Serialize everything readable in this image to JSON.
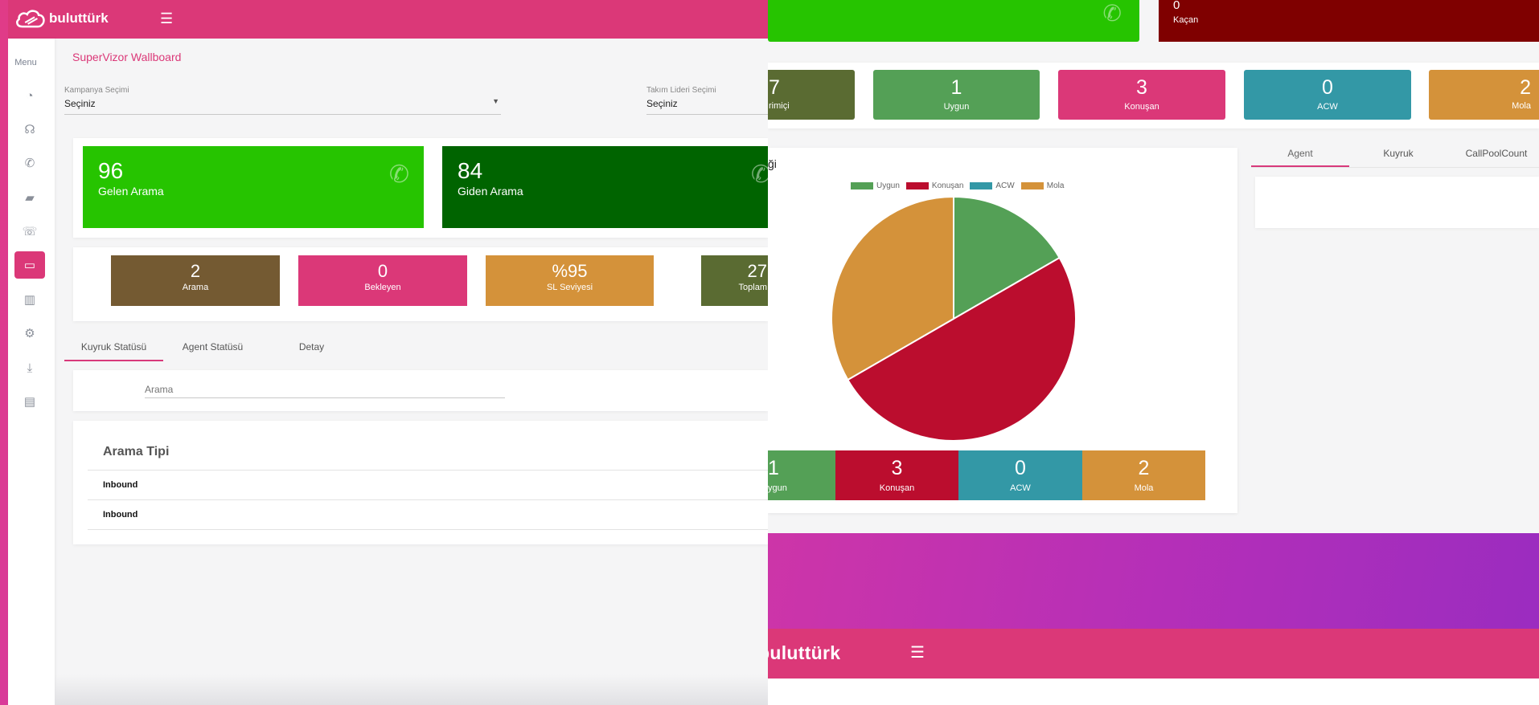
{
  "brand": {
    "name": "buluttürk",
    "primary_color": "#db3878",
    "menu_icon": "hamburger-icon"
  },
  "right_window": {
    "top_stats": [
      {
        "value": "",
        "label": "",
        "color": "#26c400"
      },
      {
        "value": "0",
        "label": "Kaçan",
        "color": "#7f0000"
      }
    ],
    "agent_stats": [
      {
        "value": "7",
        "label": "rimiçi",
        "color": "#5a6b32"
      },
      {
        "value": "1",
        "label": "Uygun",
        "color": "#54a056"
      },
      {
        "value": "3",
        "label": "Konuşan",
        "color": "#db3878"
      },
      {
        "value": "0",
        "label": "ACW",
        "color": "#3398a6"
      },
      {
        "value": "2",
        "label": "Mola",
        "color": "#d4923a"
      }
    ],
    "pie_title_fragment": "ği",
    "legend": [
      "Uygun",
      "Konuşan",
      "ACW",
      "Mola"
    ],
    "bottom_stats": [
      {
        "value": "1",
        "label": "ygun",
        "color": "#54a056"
      },
      {
        "value": "3",
        "label": "Konuşan",
        "color": "#bb0d2e"
      },
      {
        "value": "0",
        "label": "ACW",
        "color": "#3398a6"
      },
      {
        "value": "2",
        "label": "Mola",
        "color": "#d4923a"
      }
    ],
    "tabs": [
      "Agent",
      "Kuyruk",
      "CallPoolCount"
    ]
  },
  "chart_data": {
    "type": "pie",
    "categories": [
      "Uygun",
      "Konuşan",
      "ACW",
      "Mola"
    ],
    "values": [
      1,
      3,
      0,
      2
    ],
    "colors": [
      "#54a056",
      "#bb0d2e",
      "#3398a6",
      "#d4923a"
    ],
    "legend": "top"
  },
  "left_window": {
    "sidebar": {
      "menu_label": "Menu",
      "icons": [
        "history-icon",
        "headset-icon",
        "phone-forward-icon",
        "chat-icon",
        "phone-callback-icon",
        "monitor-icon",
        "bar-chart-icon",
        "settings-icon",
        "download-icon",
        "report-icon"
      ]
    },
    "page_title": "SuperVizor Wallboard",
    "filters": {
      "campaign_label": "Kampanya Seçimi",
      "campaign_value": "Seçiniz",
      "teamlead_label": "Takım Lideri Seçimi",
      "teamlead_value": "Seçiniz"
    },
    "big_stats": [
      {
        "value": "96",
        "label": "Gelen Arama",
        "color": "#26c400"
      },
      {
        "value": "84",
        "label": "Giden Arama",
        "color": "#006400"
      }
    ],
    "small_stats": [
      {
        "value": "2",
        "label": "Arama",
        "color": "#745a32"
      },
      {
        "value": "0",
        "label": "Bekleyen",
        "color": "#db3878"
      },
      {
        "value": "%95",
        "label": "SL Seviyesi",
        "color": "#d4923a"
      },
      {
        "value": "27",
        "label": "Toplam",
        "color": "#5a6b32"
      }
    ],
    "tabs": [
      "Kuyruk Statüsü",
      "Agent Statüsü",
      "Detay"
    ],
    "search": {
      "placeholder": "Arama"
    },
    "table": {
      "header": "Arama Tipi",
      "rows": [
        "Inbound",
        "Inbound"
      ]
    }
  }
}
